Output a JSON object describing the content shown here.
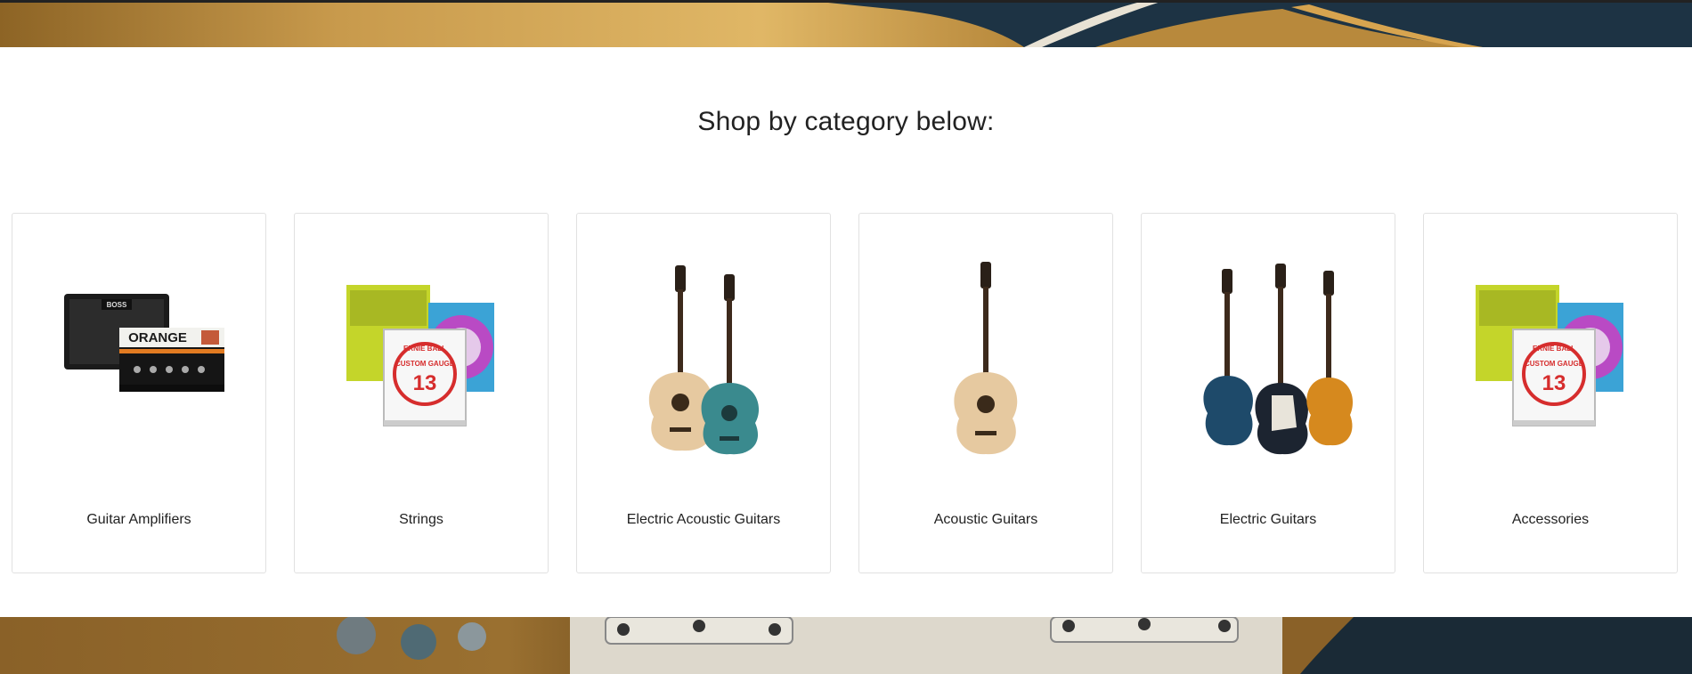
{
  "heading": "Shop by category below:",
  "categories": [
    {
      "label": "Guitar Amplifiers",
      "icon": "amplifier-icon"
    },
    {
      "label": "Strings",
      "icon": "strings-pack-icon"
    },
    {
      "label": "Electric Acoustic Guitars",
      "icon": "electric-acoustic-guitars-icon"
    },
    {
      "label": "Acoustic Guitars",
      "icon": "acoustic-guitar-icon"
    },
    {
      "label": "Electric Guitars",
      "icon": "electric-guitars-icon"
    },
    {
      "label": "Accessories",
      "icon": "accessories-icon"
    }
  ],
  "amp": {
    "brand_top": "BOSS",
    "brand_front": "ORANGE"
  },
  "strings": {
    "brand": "ERNIE BALL",
    "gauge": "13",
    "pack_text": "CUSTOM GAUGE"
  }
}
